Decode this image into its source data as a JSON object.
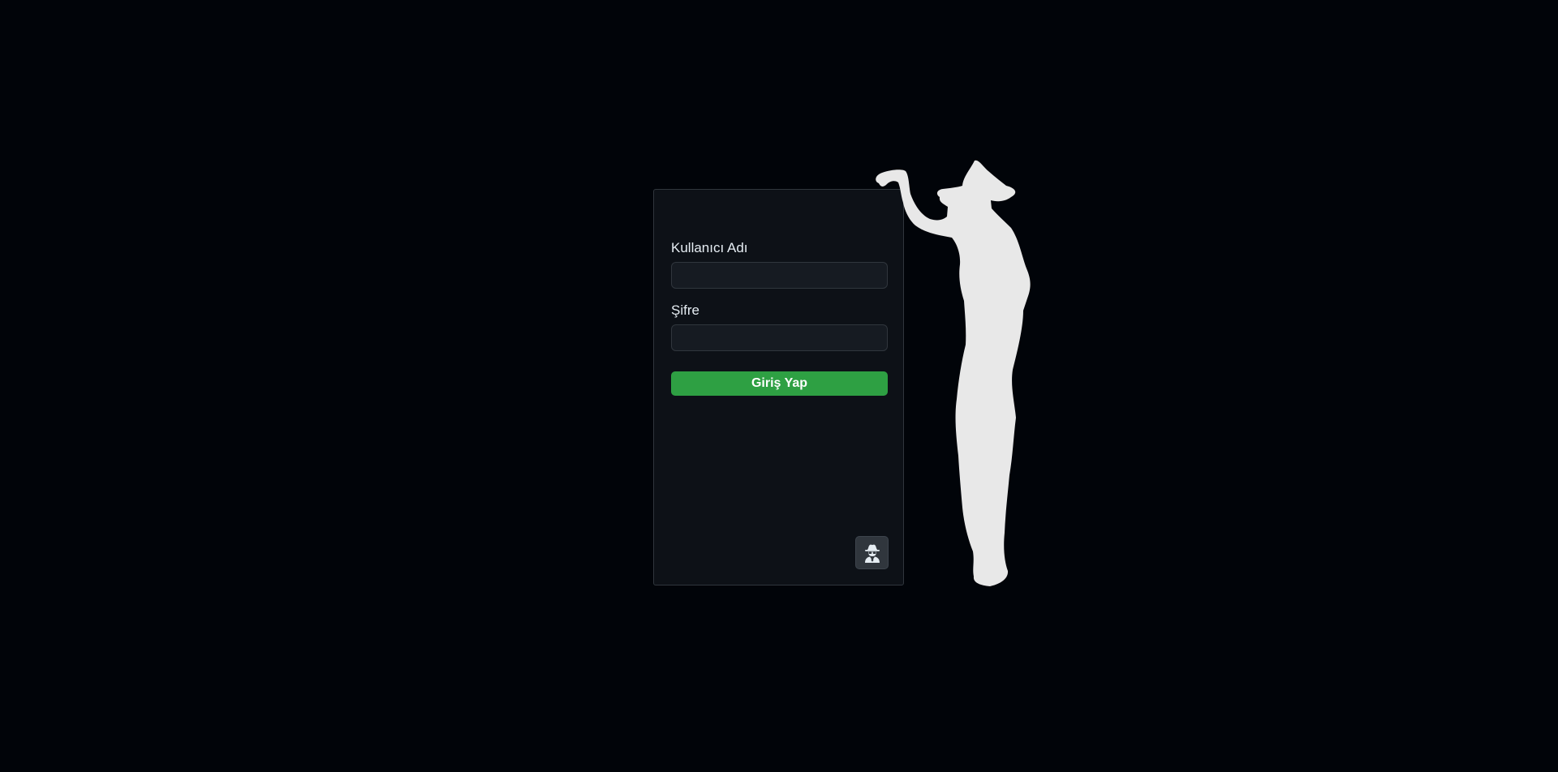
{
  "login": {
    "username_label": "Kullanıcı Adı",
    "username_value": "",
    "password_label": "Şifre",
    "password_value": "",
    "submit_label": "Giriş Yap",
    "incognito_icon": "user-secret-icon"
  },
  "decoration": {
    "figure": "cowboy-silhouette"
  },
  "colors": {
    "background": "#010409",
    "card": "#0d1117",
    "border": "#30363d",
    "input": "#161b22",
    "button_primary": "#2ea043",
    "silhouette": "#e8e8e8"
  }
}
